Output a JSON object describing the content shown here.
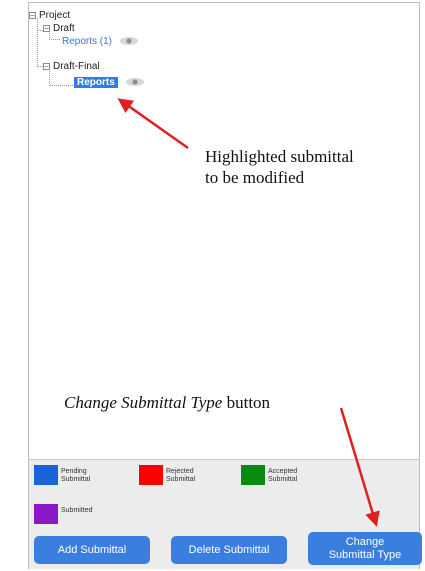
{
  "tree": {
    "root": {
      "label": "Project"
    },
    "draft": {
      "label": "Draft"
    },
    "draft_reports": {
      "label": "Reports (1)"
    },
    "draft_final": {
      "label": "Draft-Final"
    },
    "final_reports": {
      "label": "Reports"
    }
  },
  "annotations": {
    "highlight_note_line1": "Highlighted submittal",
    "highlight_note_line2": "to be modified",
    "button_note_italic": "Change Submittal Type",
    "button_note_rest": " button"
  },
  "legend": [
    {
      "label": "Pending\nSubmittal",
      "color": "#1a64d6"
    },
    {
      "label": "Rejected\nSubmittal",
      "color": "#ff0000"
    },
    {
      "label": "Accepted\nSubmittal",
      "color": "#0a8a10"
    },
    {
      "label": "Submitted",
      "color": "#8a17c8"
    }
  ],
  "buttons": {
    "add": "Add Submittal",
    "delete": "Delete Submittal",
    "change": "Change\nSubmittal Type"
  },
  "colors": {
    "selection": "#2f7fe0",
    "button": "#3a7ee0",
    "arrow": "#e02020"
  }
}
